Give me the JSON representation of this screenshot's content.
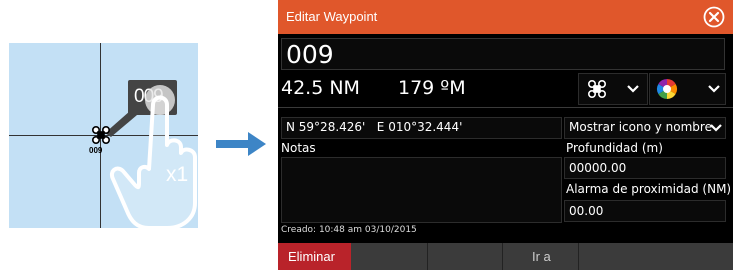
{
  "illustration": {
    "waypoint_label": "009",
    "popup_label": "009",
    "tap_count": "x1"
  },
  "dialog": {
    "title": "Editar Waypoint",
    "name": "009",
    "distance": "42.5 NM",
    "bearing": "179 ºM",
    "position": "N 59°28.426'   E 010°32.444'",
    "display_option": "Mostrar icono y nombre",
    "notes_label": "Notas",
    "notes_value": "",
    "depth_label": "Profundidad (m)",
    "depth_value": "00000.00",
    "proximity_alarm_label": "Alarma de proximidad (NM)",
    "proximity_alarm_value": "00.00",
    "created": "Creado: 10:48 am  03/10/2015",
    "delete_label": "Eliminar",
    "goto_label": "Ir a",
    "symbol_icon": "waypoint-symbol-icon",
    "color_icon": "color-wheel-icon"
  },
  "colors": {
    "titlebar": "#e0572b",
    "delete_button": "#b9232a",
    "map_background": "#c3e0f5",
    "arrow": "#3d85c6"
  }
}
